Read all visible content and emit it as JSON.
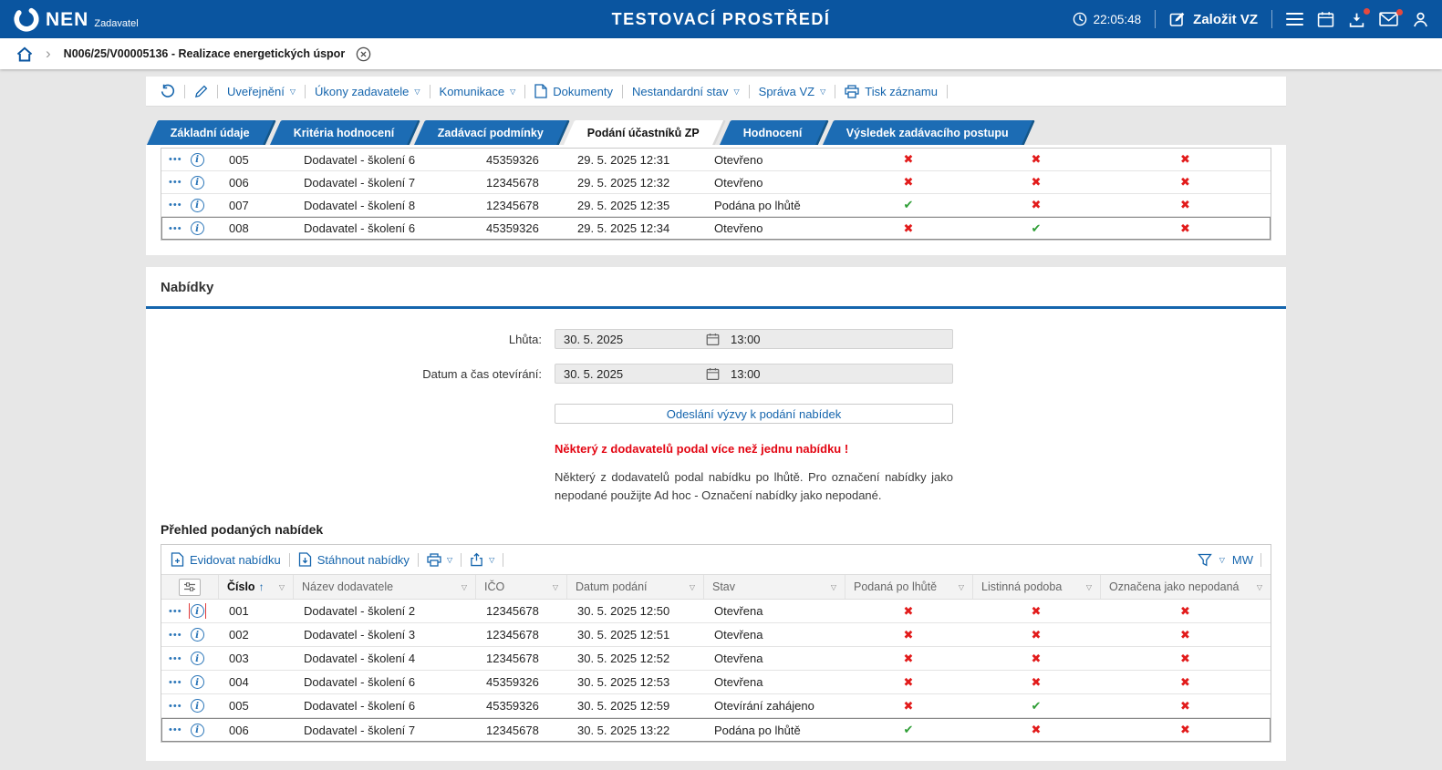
{
  "colors": {
    "brand_blue": "#0a55a0",
    "tab_blue": "#1c6cb4",
    "link_blue": "#1565ad",
    "error_red": "#e21b1b",
    "success_green": "#2e9e35",
    "badge_red": "#e5493d"
  },
  "icons": {
    "menu_dots": "•••",
    "info": "i",
    "check": "✔",
    "cross": "✖",
    "dropdown": "▽",
    "sort_asc": "↑",
    "chevron": "›"
  },
  "header": {
    "logo": "NEN",
    "logo_sub": "Zadavatel",
    "title": "TESTOVACÍ PROSTŘEDÍ",
    "time": "22:05:48",
    "create_button": "Založit VZ"
  },
  "breadcrumb": {
    "item": "N006/25/V00005136 - Realizace energetických úspor"
  },
  "actionbar": {
    "uverejneni": "Uveřejnění",
    "ukony": "Úkony zadavatele",
    "komunikace": "Komunikace",
    "dokumenty": "Dokumenty",
    "nestandardni": "Nestandardní stav",
    "sprava": "Správa VZ",
    "tisk": "Tisk záznamu"
  },
  "tabs": [
    {
      "label": "Základní údaje",
      "active": false
    },
    {
      "label": "Kritéria hodnocení",
      "active": false
    },
    {
      "label": "Zadávací podmínky",
      "active": false
    },
    {
      "label": "Podání účastníků ZP",
      "active": true
    },
    {
      "label": "Hodnocení",
      "active": false
    },
    {
      "label": "Výsledek zadávacího postupu",
      "active": false
    }
  ],
  "participants_table": {
    "rows": [
      {
        "number": "005",
        "supplier": "Dodavatel - školení 6",
        "ico": "45359326",
        "submitted": "29. 5. 2025 12:31",
        "status": "Otevřeno",
        "late": false,
        "paper": false,
        "marked_not_submitted": false
      },
      {
        "number": "006",
        "supplier": "Dodavatel - školení 7",
        "ico": "12345678",
        "submitted": "29. 5. 2025 12:32",
        "status": "Otevřeno",
        "late": false,
        "paper": false,
        "marked_not_submitted": false
      },
      {
        "number": "007",
        "supplier": "Dodavatel - školení 8",
        "ico": "12345678",
        "submitted": "29. 5. 2025 12:35",
        "status": "Podána po lhůtě",
        "late": true,
        "paper": false,
        "marked_not_submitted": false
      },
      {
        "number": "008",
        "supplier": "Dodavatel - školení 6",
        "ico": "45359326",
        "submitted": "29. 5. 2025 12:34",
        "status": "Otevřeno",
        "late": false,
        "paper": true,
        "marked_not_submitted": false,
        "selected": true
      }
    ]
  },
  "offers": {
    "section_title": "Nabídky",
    "deadline_label": "Lhůta:",
    "deadline_date": "30. 5. 2025",
    "deadline_time": "13:00",
    "opening_label": "Datum a čas otevírání:",
    "opening_date": "30. 5. 2025",
    "opening_time": "13:00",
    "send_invite_button": "Odeslání výzvy k podání nabídek",
    "warning": "Některý z dodavatelů podal více než jednu nabídku !",
    "note": "Některý z dodavatelů podal nabídku po lhůtě. Pro označení nabídky jako nepodané použijte Ad hoc - Označení nabídky jako nepodané."
  },
  "offers_table": {
    "title": "Přehled podaných nabídek",
    "toolbar": {
      "register": "Evidovat nabídku",
      "download": "Stáhnout nabídky",
      "view_name": "MW"
    },
    "columns": {
      "number": "Číslo",
      "supplier": "Název dodavatele",
      "ico": "IČO",
      "submitted": "Datum podání",
      "status": "Stav",
      "late": "Podaná po lhůtě",
      "paper": "Listinná podoba",
      "not_submitted": "Označena jako nepodaná"
    },
    "rows": [
      {
        "number": "001",
        "supplier": "Dodavatel - školení 2",
        "ico": "12345678",
        "submitted": "30. 5. 2025 12:50",
        "status": "Otevřena",
        "late": false,
        "paper": false,
        "marked_not_submitted": false,
        "info_highlight": true
      },
      {
        "number": "002",
        "supplier": "Dodavatel - školení 3",
        "ico": "12345678",
        "submitted": "30. 5. 2025 12:51",
        "status": "Otevřena",
        "late": false,
        "paper": false,
        "marked_not_submitted": false
      },
      {
        "number": "003",
        "supplier": "Dodavatel - školení 4",
        "ico": "12345678",
        "submitted": "30. 5. 2025 12:52",
        "status": "Otevřena",
        "late": false,
        "paper": false,
        "marked_not_submitted": false
      },
      {
        "number": "004",
        "supplier": "Dodavatel - školení 6",
        "ico": "45359326",
        "submitted": "30. 5. 2025 12:53",
        "status": "Otevřena",
        "late": false,
        "paper": false,
        "marked_not_submitted": false
      },
      {
        "number": "005",
        "supplier": "Dodavatel - školení 6",
        "ico": "45359326",
        "submitted": "30. 5. 2025 12:59",
        "status": "Otevírání zahájeno",
        "late": false,
        "paper": true,
        "marked_not_submitted": false
      },
      {
        "number": "006",
        "supplier": "Dodavatel - školení 7",
        "ico": "12345678",
        "submitted": "30. 5. 2025 13:22",
        "status": "Podána po lhůtě",
        "late": true,
        "paper": false,
        "marked_not_submitted": false,
        "selected": true
      }
    ]
  }
}
